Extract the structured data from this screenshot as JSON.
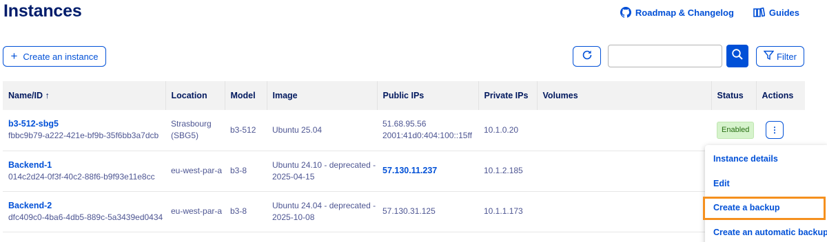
{
  "header": {
    "title": "Instances",
    "roadmap_label": "Roadmap & Changelog",
    "guides_label": "Guides"
  },
  "toolbar": {
    "create_label": "Create an instance",
    "search_placeholder": "",
    "filter_label": "Filter"
  },
  "table": {
    "columns": [
      "Name/ID",
      "Location",
      "Model",
      "Image",
      "Public IPs",
      "Private IPs",
      "Volumes",
      "Status",
      "Actions"
    ],
    "sort_indicator": "↑",
    "rows": [
      {
        "name": "b3-512-sbg5",
        "id": "fbbc9b79-a222-421e-bf9b-35f6bb3a7dcb",
        "location": "Strasbourg (SBG5)",
        "model": "b3-512",
        "image": "Ubuntu 25.04",
        "public_ips": [
          "51.68.95.56",
          "2001:41d0:404:100::15ff"
        ],
        "public_ip_link": false,
        "private_ip": "10.1.0.20",
        "volumes": "",
        "status": "Enabled"
      },
      {
        "name": "Backend-1",
        "id": "014c2d24-0f3f-40c2-88f6-b9f93e11e8cc",
        "location": "eu-west-par-a",
        "model": "b3-8",
        "image": "Ubuntu 24.10 - deprecated - 2025-04-15",
        "public_ips": [
          "57.130.11.237"
        ],
        "public_ip_link": true,
        "private_ip": "10.1.2.185",
        "volumes": "",
        "status": ""
      },
      {
        "name": "Backend-2",
        "id": "dfc409c0-4ba6-4db5-889c-5a3439ed0434",
        "location": "eu-west-par-a",
        "model": "b3-8",
        "image": "Ubuntu 24.04 - deprecated - 2025-10-08",
        "public_ips": [
          "57.130.31.125"
        ],
        "public_ip_link": false,
        "private_ip": "10.1.1.173",
        "volumes": "",
        "status": ""
      }
    ]
  },
  "actions_menu": {
    "items": [
      "Instance details",
      "Edit",
      "Create a backup",
      "Create an automatic backup"
    ],
    "highlighted": "Create a backup"
  },
  "colors": {
    "accent": "#0050d7",
    "title": "#001c6b",
    "highlight": "#f5901e",
    "badge_bg": "#d6f3cc"
  }
}
